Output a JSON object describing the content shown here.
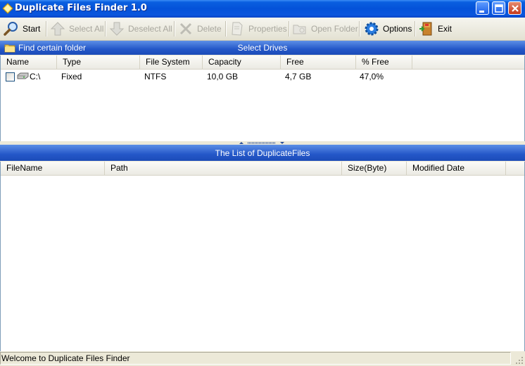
{
  "window": {
    "title": "Duplicate Files Finder 1.0",
    "icon": "diamond-app-icon",
    "controls": [
      "minimize",
      "maximize",
      "close"
    ]
  },
  "toolbar": {
    "items": [
      {
        "label": "Start",
        "icon": "magnifier-icon",
        "enabled": true
      },
      {
        "label": "Select All",
        "icon": "arrow-up-icon",
        "enabled": false
      },
      {
        "label": "Deselect All",
        "icon": "arrow-down-icon",
        "enabled": false
      },
      {
        "label": "Delete",
        "icon": "x-delete-icon",
        "enabled": false
      },
      {
        "label": "Properties",
        "icon": "document-icon",
        "enabled": false
      },
      {
        "label": "Open Folder",
        "icon": "folder-icon",
        "enabled": false
      },
      {
        "label": "Options",
        "icon": "gear-icon",
        "enabled": true
      },
      {
        "label": "Exit",
        "icon": "exit-door-icon",
        "enabled": true
      }
    ]
  },
  "drives_section": {
    "find_folder_label": "Find certain folder",
    "title": "Select Drives",
    "columns": [
      "Name",
      "Type",
      "File System",
      "Capacity",
      "Free",
      "% Free"
    ],
    "rows": [
      {
        "checked": false,
        "name": "C:\\",
        "type": "Fixed",
        "file_system": "NTFS",
        "capacity": "10,0 GB",
        "free": "4,7 GB",
        "percent_free": "47,0%"
      }
    ]
  },
  "duplicates_section": {
    "title": "The List of DuplicateFiles",
    "columns": [
      "FileName",
      "Path",
      "Size(Byte)",
      "Modified Date"
    ],
    "rows": []
  },
  "status": {
    "text": "Welcome to Duplicate Files Finder"
  },
  "colors": {
    "titlebar": "#0452d9",
    "section_header": "#2457c8",
    "toolbar_bg": "#ece9d8",
    "disabled_text": "#a8a79e"
  }
}
